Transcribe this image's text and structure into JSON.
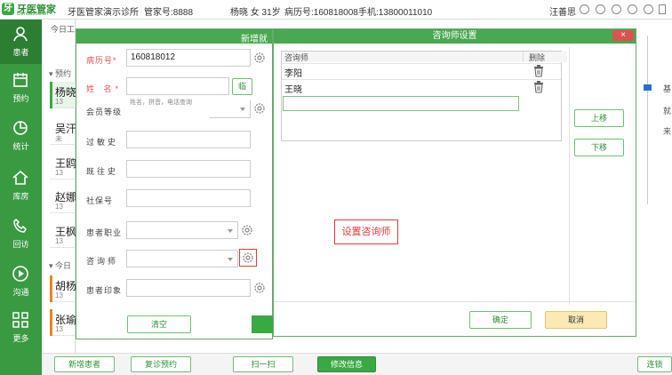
{
  "app": {
    "logo_cn": "牙医管家",
    "logo_en": "Dental360.cn",
    "logo_mark": "牙",
    "clinic": "牙医管家演示诊所",
    "account": "管家号:8888",
    "patient_summary": "杨晓 女 31岁",
    "record_no": "病历号:160818008",
    "phone": "手机:13800011010",
    "user": "汪善思"
  },
  "sidebar": {
    "items": [
      {
        "label": "患者",
        "icon": "user-icon"
      },
      {
        "label": "预约",
        "icon": "calendar-icon"
      },
      {
        "label": "统计",
        "icon": "pie-chart-icon"
      },
      {
        "label": "库房",
        "icon": "house-icon"
      },
      {
        "label": "回访",
        "icon": "phone-icon"
      },
      {
        "label": "沟通",
        "icon": "play-icon"
      },
      {
        "label": "更多",
        "icon": "grid-icon"
      }
    ]
  },
  "list": {
    "tab": "今日工",
    "group1": "预约",
    "group2": "今日",
    "patients": [
      {
        "name": "杨晓",
        "sub": "13",
        "color": "#f0a030"
      },
      {
        "name": "吴汗",
        "sub": "未",
        "color": "#ffffff"
      },
      {
        "name": "王鸥",
        "sub": "13",
        "color": "#ffffff"
      },
      {
        "name": "赵娜",
        "sub": "13",
        "color": "#ffffff"
      },
      {
        "name": "王枫",
        "sub": "13",
        "color": "#ffffff"
      },
      {
        "name": "胡杨",
        "sub": "13",
        "color": "#f08020"
      },
      {
        "name": "张瑜",
        "sub": "13",
        "color": "#f08020"
      }
    ]
  },
  "bottom": {
    "new_patient": "新增患者",
    "revisit": "复诊预约",
    "scan": "扫一扫",
    "edit_info": "修改信息",
    "connect": "连锁"
  },
  "form_dialog": {
    "title": "新增就",
    "fields": {
      "record_no_label": "病历号*",
      "record_no_value": "160818012",
      "name_label": "姓  名*",
      "name_button": "临",
      "name_hint": "姓名，拼音，电话查询",
      "member_label": "会员等级",
      "allergy_label": "过敏史",
      "history_label": "既往史",
      "insurance_label": "社保号",
      "occupation_label": "患者职业",
      "consultant_label": "咨询师",
      "impression_label": "患者印象"
    },
    "clear_button": "清空"
  },
  "consultant_dialog": {
    "title": "咨询师设置",
    "close": "×",
    "col_name": "咨询师",
    "col_delete": "删除",
    "rows": [
      "李阳",
      "王晓"
    ],
    "move_up": "上移",
    "move_down": "下移",
    "confirm": "确定",
    "cancel": "取消"
  },
  "annotation": {
    "text": "设置咨询师",
    "color": "#e03a3a"
  },
  "right_panel": {
    "item1": "基",
    "item2": "就",
    "item3": "来"
  },
  "colors": {
    "brand_green": "#3aa843",
    "dark_green": "#2c7e33",
    "title_green": "#49a851",
    "red": "#e03a3a"
  }
}
